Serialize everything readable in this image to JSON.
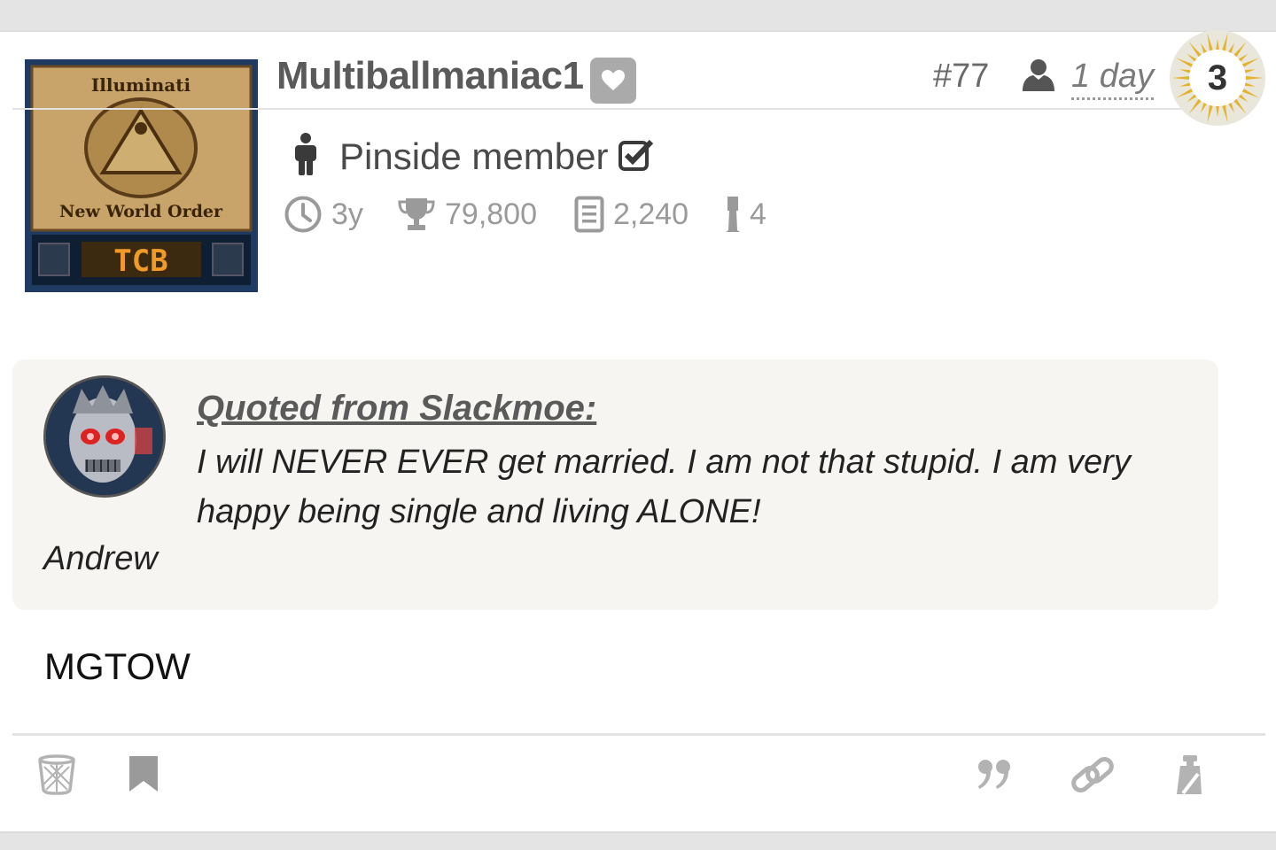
{
  "post": {
    "username": "Multiballmaniac1",
    "post_number": "#77",
    "time_ago": "1 day",
    "badge_count": "3",
    "member_type": "Pinside member",
    "stats": {
      "membership_age": "3y",
      "score": "79,800",
      "posts": "2,240",
      "machines": "4"
    },
    "avatar_text": {
      "top": "Illuminati",
      "middle": "New World Order",
      "display": "TCB"
    },
    "body": "MGTOW"
  },
  "quote": {
    "from_label": "Quoted from Slackmoe:",
    "text": "I will NEVER EVER get married. I am not that stupid. I am very happy being single and living ALONE!",
    "signature": "Andrew"
  },
  "icons": {
    "favorite": "heart-icon",
    "user": "user-icon",
    "member": "person-icon",
    "verified": "checkbox-icon",
    "age": "clock-icon",
    "score": "trophy-icon",
    "posts": "document-icon",
    "machines": "pinball-leg-icon",
    "delete": "trash-icon",
    "bookmark": "bookmark-icon",
    "quote": "quote-icon",
    "link": "link-icon",
    "report": "report-icon"
  },
  "colors": {
    "badge_gold": "#e5b22c",
    "quote_background": "#f6f5f1",
    "heart_button": "#aaaaaa"
  }
}
